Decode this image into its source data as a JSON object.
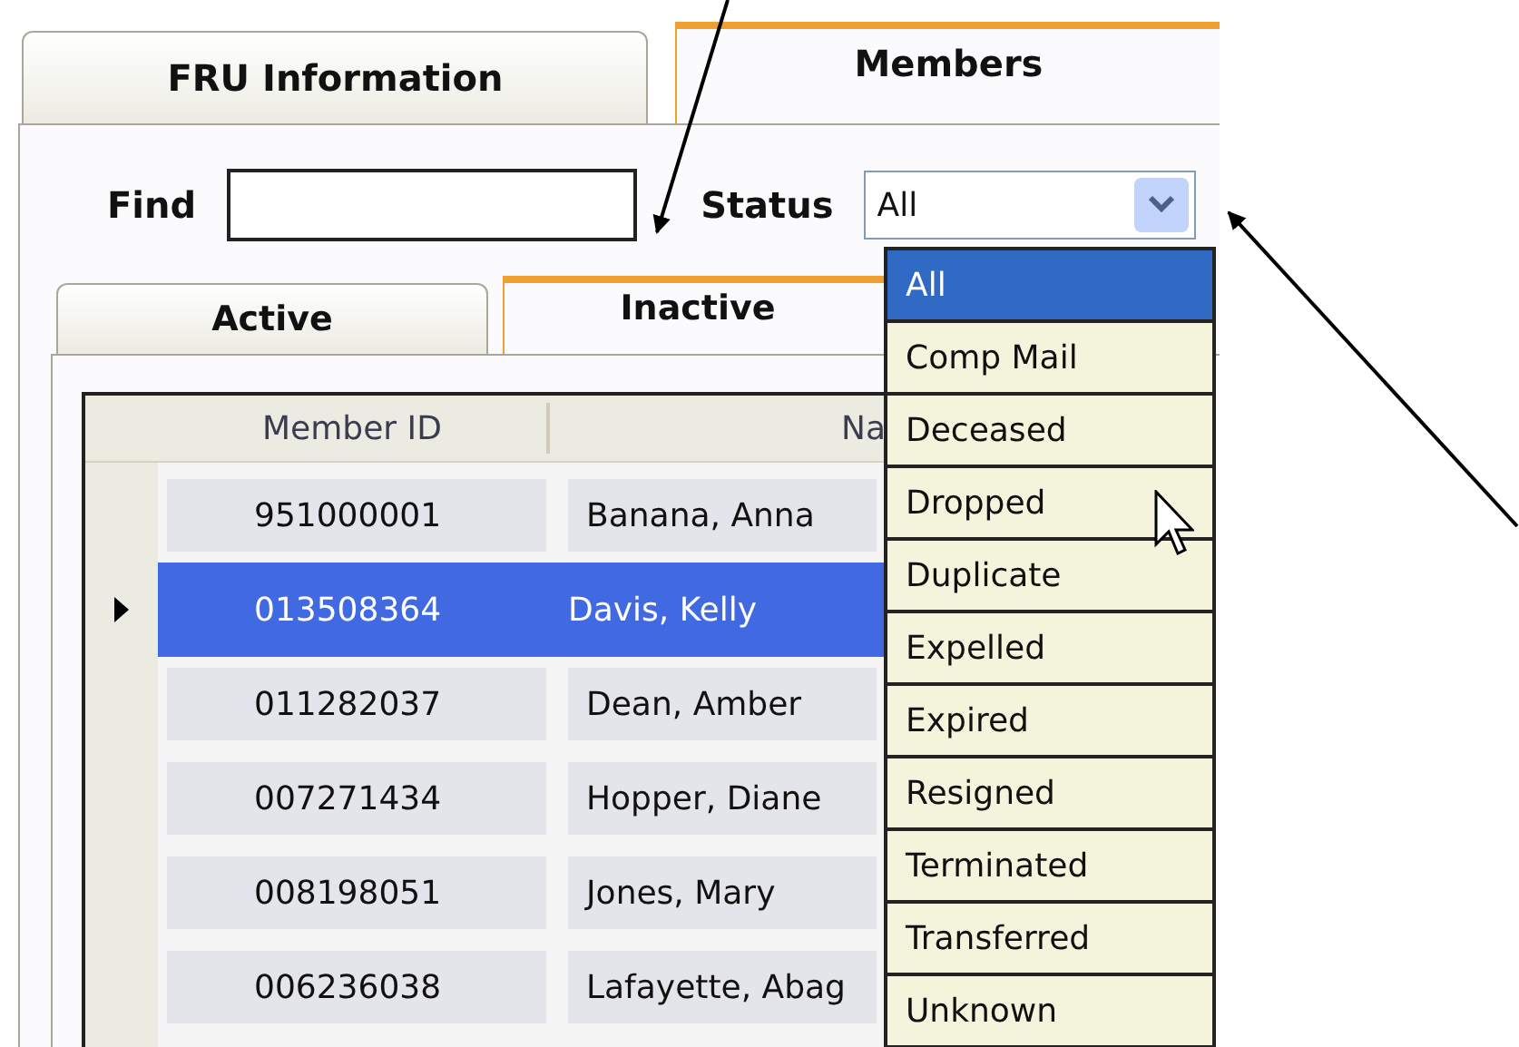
{
  "outer_tabs": [
    {
      "label": "FRU Information",
      "selected": false
    },
    {
      "label": "Members",
      "selected": true
    }
  ],
  "find": {
    "label": "Find"
  },
  "status": {
    "label": "Status",
    "value": "All",
    "expanded": true,
    "options": [
      {
        "label": "All",
        "selected": true
      },
      {
        "label": "Comp Mail",
        "selected": false
      },
      {
        "label": "Deceased",
        "selected": false
      },
      {
        "label": "Dropped",
        "selected": false
      },
      {
        "label": "Duplicate",
        "selected": false
      },
      {
        "label": "Expelled",
        "selected": false
      },
      {
        "label": "Expired",
        "selected": false
      },
      {
        "label": "Resigned",
        "selected": false
      },
      {
        "label": "Terminated",
        "selected": false
      },
      {
        "label": "Transferred",
        "selected": false
      },
      {
        "label": "Unknown",
        "selected": false
      }
    ]
  },
  "inner_tabs": [
    {
      "label": "Active",
      "selected": false
    },
    {
      "label": "Inactive",
      "selected": true
    }
  ],
  "grid": {
    "columns": [
      "Member ID",
      "Na"
    ],
    "rows": [
      {
        "member_id": "951000001",
        "name": "Banana, Anna",
        "selected": false
      },
      {
        "member_id": "013508364",
        "name": "Davis, Kelly",
        "selected": true
      },
      {
        "member_id": "011282037",
        "name": "Dean, Amber",
        "selected": false
      },
      {
        "member_id": "007271434",
        "name": "Hopper, Diane",
        "selected": false
      },
      {
        "member_id": "008198051",
        "name": "Jones, Mary",
        "selected": false
      },
      {
        "member_id": "006236038",
        "name": "Lafayette, Abag",
        "selected": false
      }
    ]
  }
}
